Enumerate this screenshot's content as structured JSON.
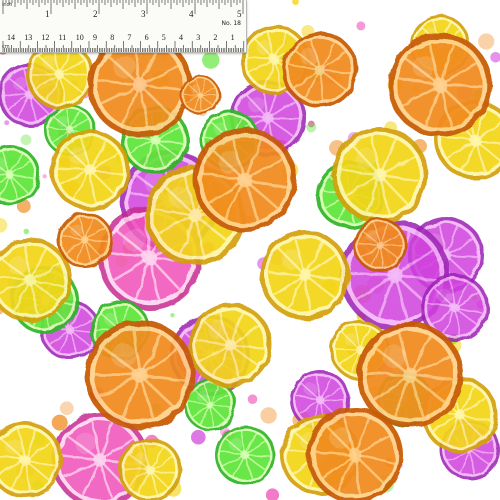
{
  "artwork": {
    "subject": "watercolor citrus slices fabric print",
    "colors": {
      "orange": "#f08a1c",
      "yellow": "#f3d51a",
      "lime": "#5fe63a",
      "magenta": "#cf3fdc",
      "pink": "#ef4fb8",
      "background": "#ffffff"
    }
  },
  "ruler": {
    "inch_unit": "inch",
    "inch_marks": [
      "1",
      "2",
      "3",
      "4",
      "5"
    ],
    "number_label": "No. 18",
    "cm_unit": "cm",
    "cm_marks": [
      "14",
      "13",
      "12",
      "11",
      "10",
      "9",
      "8",
      "7",
      "6",
      "5",
      "4",
      "3",
      "2",
      "1"
    ]
  }
}
